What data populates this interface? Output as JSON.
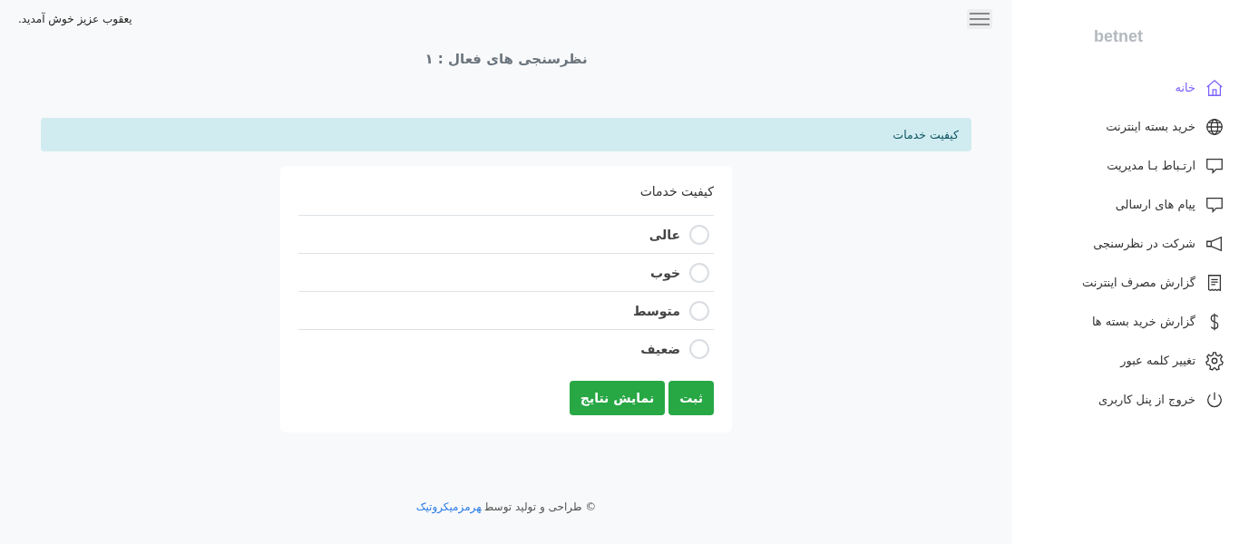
{
  "sidebar": {
    "logo": "betnet",
    "items": [
      {
        "label": "خانه",
        "selected": true
      },
      {
        "label": "خرید بسته اینترنت",
        "selected": false
      },
      {
        "label": "ارتـباط بـا مدیریت",
        "selected": false
      },
      {
        "label": "پیام های ارسالی",
        "selected": false
      },
      {
        "label": "شرکت در نظرسنجی",
        "selected": false
      },
      {
        "label": "گزارش مصرف اینترنت",
        "selected": false
      },
      {
        "label": "گزارش خرید بسته ها",
        "selected": false
      },
      {
        "label": "تغییر کلمه عبور",
        "selected": false
      },
      {
        "label": "خروج از پنل کاربری",
        "selected": false
      }
    ]
  },
  "header": {
    "welcome": "یعقوب عزیز خوش آمدید."
  },
  "page_title": "نظرسنجی های فعال : ۱",
  "alert": "کیفیت خدمات",
  "poll": {
    "question": "کیفیت خدمات",
    "options": [
      {
        "label": "عالی",
        "selected": false
      },
      {
        "label": "خوب",
        "selected": false
      },
      {
        "label": "متوسط",
        "selected": false
      },
      {
        "label": "ضعیف",
        "selected": false
      }
    ],
    "buttons": [
      "ثبت",
      "نمایش نتایج"
    ]
  },
  "footer": {
    "text": "© طراحی و تولید توسط",
    "link": "هرمزمیکروتیک"
  }
}
